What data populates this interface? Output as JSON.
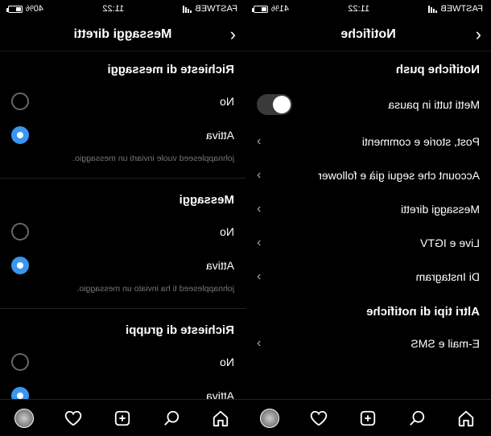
{
  "phone_right": {
    "status": {
      "time": "11:22",
      "carrier": "FASTWEB",
      "battery_pct": "41%"
    },
    "header": {
      "title": "Notifiche"
    },
    "push_section": "Notifiche push",
    "pause_all": "Metti tutti in pausa",
    "nav_rows": [
      "Post, storie e commenti",
      "Account che segui già e follower",
      "Messaggi diretti",
      "Live e IGTV",
      "Di Instagram"
    ],
    "other_section": "Altri tipi di notifiche",
    "other_rows": [
      "E-mail e SMS"
    ]
  },
  "phone_left": {
    "status": {
      "time": "11:22",
      "carrier": "FASTWEB",
      "battery_pct": "40%"
    },
    "header": {
      "title": "Messaggi diretti"
    },
    "sections": [
      {
        "title": "Richieste di messaggi",
        "options": {
          "off": "No",
          "on": "Attiva"
        },
        "hint": "johnappleseed vuole inviarti un messaggio."
      },
      {
        "title": "Messaggi",
        "options": {
          "off": "No",
          "on": "Attiva"
        },
        "hint": "johnappleseed ti ha inviato un messaggio."
      },
      {
        "title": "Richieste di gruppi",
        "options": {
          "off": "No",
          "on": "Attiva"
        }
      }
    ]
  }
}
